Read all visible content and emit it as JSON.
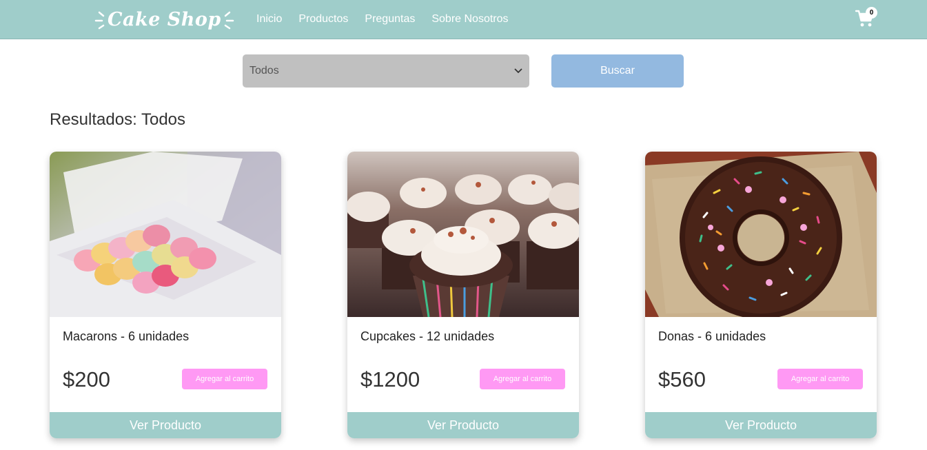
{
  "brand": {
    "name": "Cake Shop",
    "icon": "logo-rays"
  },
  "nav": {
    "links": [
      "Inicio",
      "Productos",
      "Preguntas",
      "Sobre Nosotros"
    ],
    "cart_count": "0",
    "cart_icon": "cart-icon"
  },
  "filter": {
    "selected": "Todos",
    "search_label": "Buscar"
  },
  "results": {
    "title": "Resultados: Todos"
  },
  "products": [
    {
      "name": "Macarons - 6 unidades",
      "price": "$200",
      "add_label": "Agregar al carrito",
      "view_label": "Ver Producto"
    },
    {
      "name": "Cupcakes - 12 unidades",
      "price": "$1200",
      "add_label": "Agregar al carrito",
      "view_label": "Ver Producto"
    },
    {
      "name": "Donas - 6 unidades",
      "price": "$560",
      "add_label": "Agregar al carrito",
      "view_label": "Ver Producto"
    }
  ],
  "colors": {
    "accent": "#9fcdca",
    "search_button": "#93b9e0",
    "cart_button": "#ff99f4",
    "select_bg": "#c0c0c0"
  }
}
